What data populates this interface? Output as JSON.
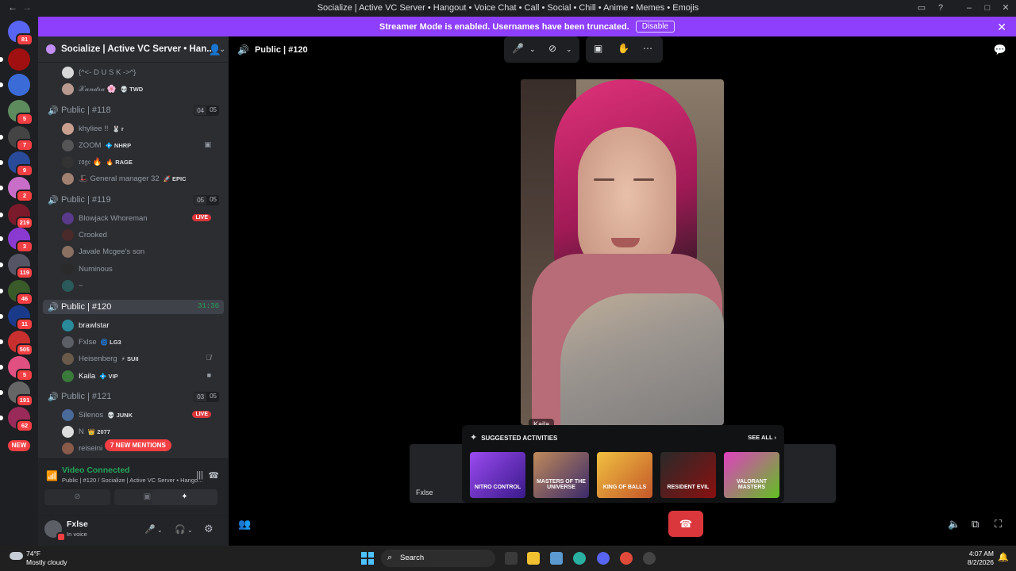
{
  "window": {
    "title": "Socialize | Active VC Server • Hangout • Voice Chat • Call • Social • Chill • Anime • Memes • Emojis",
    "back_icon": "arrow-left-icon",
    "forward_icon": "arrow-right-icon"
  },
  "rail": {
    "home_badge": "81",
    "badges": [
      "5",
      "7",
      "9",
      "2",
      "219",
      "3",
      "119",
      "46",
      "11",
      "505",
      "5",
      "191",
      "62"
    ],
    "new_label": "NEW"
  },
  "banner": {
    "text": "Streamer Mode is enabled. Usernames have been truncated.",
    "button": "Disable"
  },
  "server": {
    "name": "Socialize | Active VC Server • Han..."
  },
  "channels": {
    "prev_members": [
      {
        "name": "{^<- D U S K ->^}",
        "tag": ""
      },
      {
        "name": "𝒳𝒶𝓃𝒹𝓇𝒶 🌸",
        "tag": "💀 TWD"
      }
    ],
    "ch118": {
      "label": "Public | #118",
      "count_a": "04",
      "count_b": "05",
      "members": [
        {
          "name": "khyliee !!",
          "tag": "🐰 r"
        },
        {
          "name": "ZOOM",
          "tag": "💠 NHRP"
        },
        {
          "name": "𝔯𝔞𝔤𝔢 🔥",
          "tag": "🔥 RAGE"
        },
        {
          "name": "🎩 General manager 32",
          "tag": "🚀 EPIC"
        }
      ]
    },
    "ch119": {
      "label": "Public | #119",
      "count_a": "05",
      "count_b": "05",
      "members": [
        {
          "name": "Blowjack Whoreman",
          "tag": ""
        },
        {
          "name": "Crooked",
          "tag": ""
        },
        {
          "name": "Javale Mcgee's son",
          "tag": ""
        },
        {
          "name": "Numinous",
          "tag": ""
        },
        {
          "name": "~",
          "tag": ""
        }
      ],
      "live": "LIVE"
    },
    "ch120": {
      "label": "Public | #120",
      "timer": "31:36",
      "members": [
        {
          "name": "brawlstar",
          "tag": ""
        },
        {
          "name": "Fxlse",
          "tag": "🌀 LG3"
        },
        {
          "name": "Heisenberg",
          "tag": "⚡ SUII"
        },
        {
          "name": "Kaila",
          "tag": "💠 VIP"
        }
      ]
    },
    "ch121": {
      "label": "Public | #121",
      "count_a": "03",
      "count_b": "05",
      "members": [
        {
          "name": "Silenos",
          "tag": "💀 JUNK"
        },
        {
          "name": "N",
          "tag": "👑 2077"
        },
        {
          "name": "reiseini",
          "tag": ""
        }
      ],
      "live": "LIVE"
    },
    "mentions": "7 NEW MENTIONS"
  },
  "voice": {
    "status": "Video Connected",
    "location": "Public | #120 / Socialize | Active VC Server • Hango..."
  },
  "user": {
    "name": "Fxlse",
    "status": "In voice"
  },
  "main": {
    "channel": "Public | #120",
    "video_name": "Kaila",
    "tile_name": "Fxlse"
  },
  "activities": {
    "title": "SUGGESTED ACTIVITIES",
    "see_all": "SEE ALL",
    "items": [
      {
        "name": "NITRO CONTROL",
        "color": "#6a2ad0"
      },
      {
        "name": "MASTERS OF THE UNIVERSE",
        "color": "#7a4a2a"
      },
      {
        "name": "KING OF BALLS",
        "color": "#c4582a"
      },
      {
        "name": "RESIDENT EVIL",
        "color": "#4a1010"
      },
      {
        "name": "VALORANT MASTERS",
        "color": "#b43cc6"
      }
    ]
  },
  "taskbar": {
    "temp": "74°F",
    "weather": "Mostly cloudy",
    "search": "Search",
    "time": "4:07 AM",
    "date": "8/2/2026"
  },
  "colors": {
    "accent": "#8d3ffb",
    "voice_green": "#23a55a",
    "danger": "#da373c"
  }
}
